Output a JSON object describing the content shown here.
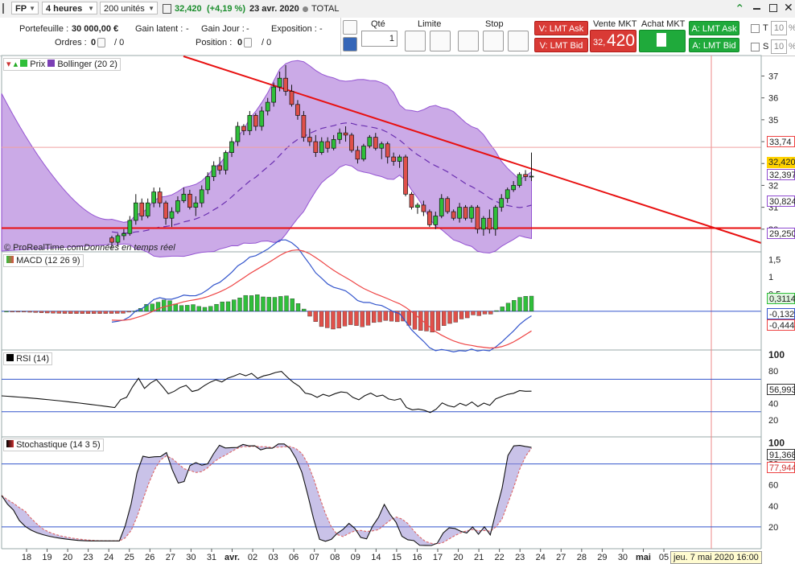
{
  "toolbar": {
    "symbol": "FP",
    "timeframe": "4 heures",
    "units": "200 unités",
    "price": "32,420",
    "change": "(+4,19 %)",
    "date": "23 avr. 2020",
    "total": "TOTAL"
  },
  "account": {
    "portefeuille_label": "Portefeuille :",
    "portefeuille_value": "30 000,00 €",
    "gain_latent_label": "Gain latent :",
    "gain_latent_value": "-",
    "gain_jour_label": "Gain Jour :",
    "gain_jour_value": "-",
    "exposition_label": "Exposition :",
    "exposition_value": "-",
    "ordres_label": "Ordres :",
    "ordres_value": "0",
    "ordres_slash": "/ 0",
    "position_label": "Position :",
    "position_value": "0",
    "position_slash": "/ 0"
  },
  "order": {
    "qte_label": "Qté",
    "qte_value": "1",
    "limite_label": "Limite",
    "stop_label": "Stop",
    "v_lmt_ask": "V: LMT Ask",
    "v_lmt_bid": "V: LMT Bid",
    "vente_label": "Vente MKT",
    "vente_price_small": "32,",
    "vente_price_big": "420",
    "achat_label": "Achat MKT",
    "a_lmt_ask": "A: LMT Ask",
    "a_lmt_bid": "A: LMT Bid",
    "t_label": "T",
    "s_label": "S",
    "t_value": "10",
    "s_value": "10",
    "spin_arrow": "%"
  },
  "legends": {
    "prix": "Prix",
    "bollinger": "Bollinger (20 2)",
    "macd": "MACD (12 26 9)",
    "rsi": "RSI (14)",
    "stoch": "Stochastique (14 3 5)",
    "watermark1": "© ProRealTime.com",
    "watermark2": "Données en temps réel"
  },
  "price_axis": [
    "37",
    "36",
    "35",
    "34",
    "33",
    "32",
    "31",
    "30"
  ],
  "price_tags": {
    "hline": "33,74",
    "last": "32,420",
    "bb_upper": "32,397",
    "bb_mid": "30,824",
    "bb_lower": "29,250"
  },
  "macd_axis": [
    "1,5",
    "1",
    "0,5",
    "0"
  ],
  "macd_tags": {
    "hist": "0,3114",
    "macd": "-0,1329",
    "signal": "-0,4447"
  },
  "rsi_axis": [
    "100",
    "80",
    "60",
    "40",
    "20"
  ],
  "rsi_tag": "56,993",
  "stoch_axis": [
    "100",
    "80",
    "60",
    "40",
    "20"
  ],
  "stoch_tags": {
    "k": "91,368",
    "d": "77,944"
  },
  "x_axis": [
    "18",
    "19",
    "20",
    "23",
    "24",
    "25",
    "26",
    "27",
    "30",
    "31",
    "avr.",
    "02",
    "03",
    "06",
    "07",
    "08",
    "09",
    "14",
    "15",
    "16",
    "17",
    "20",
    "21",
    "22",
    "23",
    "24",
    "27",
    "28",
    "29",
    "30",
    "mai",
    "05"
  ],
  "cursor_date": "jeu. 7 mai 2020 16:00",
  "colors": {
    "bull": "#2fbf3a",
    "bear": "#e0504a",
    "bollinger_fill": "#c9a6e6",
    "trendline": "#e81010",
    "macd_pos": "#2fbf3a",
    "macd_neg": "#e0504a"
  },
  "chart_data": {
    "type": "candlestick",
    "candles": [
      [
        29.6,
        29.7,
        29.1,
        29.4
      ],
      [
        29.4,
        29.8,
        29.2,
        29.7
      ],
      [
        29.7,
        30.0,
        29.5,
        29.8
      ],
      [
        29.8,
        30.6,
        29.7,
        30.4
      ],
      [
        30.4,
        31.6,
        30.2,
        31.2
      ],
      [
        31.2,
        31.4,
        30.4,
        30.6
      ],
      [
        30.6,
        31.4,
        30.5,
        31.2
      ],
      [
        31.2,
        31.9,
        31.0,
        31.7
      ],
      [
        31.7,
        31.9,
        31.0,
        31.2
      ],
      [
        31.2,
        31.3,
        30.2,
        30.5
      ],
      [
        30.5,
        31.0,
        30.1,
        30.8
      ],
      [
        30.8,
        31.5,
        30.7,
        31.3
      ],
      [
        31.3,
        31.9,
        31.2,
        31.6
      ],
      [
        31.6,
        31.8,
        30.9,
        31.0
      ],
      [
        31.0,
        31.5,
        30.6,
        31.2
      ],
      [
        31.2,
        32.0,
        31.0,
        31.8
      ],
      [
        31.8,
        32.6,
        31.6,
        32.4
      ],
      [
        32.4,
        33.1,
        32.2,
        32.9
      ],
      [
        32.9,
        33.3,
        32.5,
        32.7
      ],
      [
        32.7,
        33.6,
        32.5,
        33.5
      ],
      [
        33.5,
        34.2,
        33.3,
        34.0
      ],
      [
        34.0,
        34.9,
        33.8,
        34.7
      ],
      [
        34.7,
        34.8,
        34.3,
        34.5
      ],
      [
        34.5,
        35.4,
        34.3,
        35.2
      ],
      [
        35.2,
        35.3,
        34.5,
        34.7
      ],
      [
        34.7,
        35.6,
        34.5,
        35.4
      ],
      [
        35.4,
        36.0,
        35.2,
        35.8
      ],
      [
        35.8,
        36.7,
        35.6,
        36.5
      ],
      [
        36.5,
        37.2,
        36.3,
        36.9
      ],
      [
        36.9,
        37.5,
        36.1,
        36.3
      ],
      [
        36.3,
        36.6,
        35.6,
        35.7
      ],
      [
        35.7,
        35.9,
        35.0,
        35.2
      ],
      [
        35.2,
        35.4,
        34.0,
        34.2
      ],
      [
        34.2,
        34.6,
        33.8,
        34.0
      ],
      [
        34.0,
        34.3,
        33.3,
        33.5
      ],
      [
        33.5,
        34.2,
        33.4,
        34.0
      ],
      [
        34.0,
        34.2,
        33.5,
        33.7
      ],
      [
        33.7,
        34.3,
        33.6,
        34.1
      ],
      [
        34.1,
        34.6,
        33.9,
        34.4
      ],
      [
        34.4,
        34.7,
        34.0,
        34.3
      ],
      [
        34.3,
        34.4,
        33.5,
        33.6
      ],
      [
        33.6,
        33.8,
        33.0,
        33.2
      ],
      [
        33.2,
        33.9,
        33.1,
        33.8
      ],
      [
        33.8,
        34.3,
        33.7,
        34.2
      ],
      [
        34.2,
        34.4,
        33.6,
        33.7
      ],
      [
        33.7,
        34.0,
        33.2,
        33.9
      ],
      [
        33.9,
        34.0,
        33.0,
        33.3
      ],
      [
        33.3,
        33.5,
        32.9,
        33.1
      ],
      [
        33.1,
        33.4,
        32.8,
        33.3
      ],
      [
        33.3,
        33.4,
        31.5,
        31.6
      ],
      [
        31.6,
        31.7,
        30.9,
        31.0
      ],
      [
        31.0,
        31.2,
        30.7,
        31.1
      ],
      [
        31.1,
        31.3,
        30.6,
        30.8
      ],
      [
        30.8,
        30.9,
        30.1,
        30.2
      ],
      [
        30.2,
        30.8,
        30.0,
        30.6
      ],
      [
        30.6,
        31.6,
        30.5,
        31.4
      ],
      [
        31.4,
        31.5,
        30.7,
        30.8
      ],
      [
        30.8,
        30.9,
        30.4,
        30.5
      ],
      [
        30.5,
        31.2,
        30.3,
        31.0
      ],
      [
        31.0,
        31.1,
        30.4,
        30.5
      ],
      [
        30.5,
        31.1,
        30.3,
        31.0
      ],
      [
        31.0,
        31.1,
        29.8,
        30.0
      ],
      [
        30.0,
        30.6,
        29.7,
        30.5
      ],
      [
        30.5,
        30.9,
        29.8,
        30.0
      ],
      [
        30.0,
        31.1,
        29.7,
        31.0
      ],
      [
        31.0,
        31.6,
        30.8,
        31.4
      ],
      [
        31.4,
        31.9,
        31.2,
        31.8
      ],
      [
        31.8,
        32.2,
        31.7,
        32.0
      ],
      [
        32.0,
        32.6,
        31.9,
        32.5
      ],
      [
        32.5,
        32.7,
        32.2,
        32.4
      ],
      [
        32.4,
        33.5,
        32.2,
        32.42
      ]
    ],
    "bollinger": {
      "period": 20,
      "mult": 2
    },
    "ylim": [
      29.0,
      37.9
    ],
    "hline": 33.74,
    "support": 30.05
  }
}
